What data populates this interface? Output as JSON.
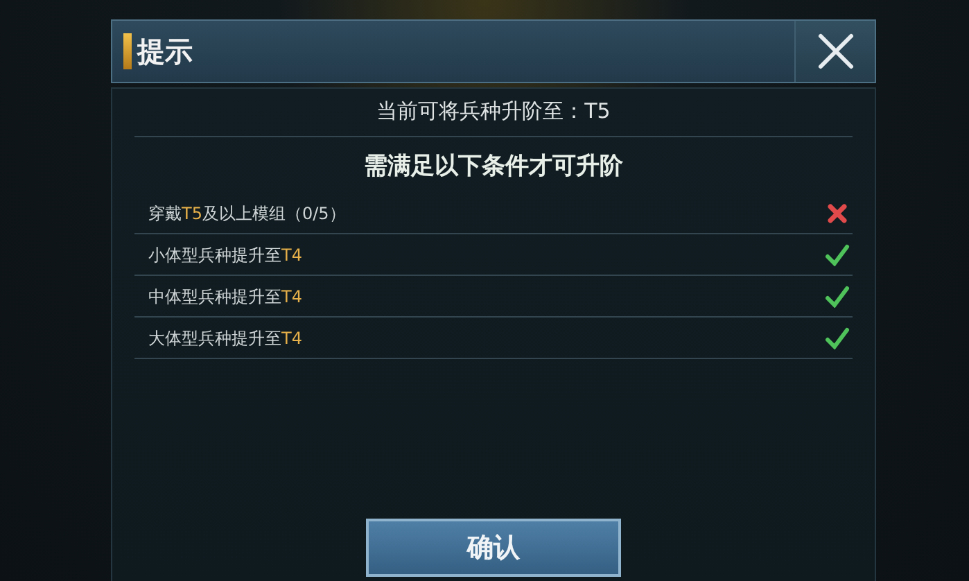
{
  "dialog": {
    "title": "提示",
    "subtitle": "当前可将兵种升阶至：T5",
    "heading": "需满足以下条件才可升阶",
    "conditions": [
      {
        "prefix": "穿戴",
        "tier": "T5",
        "suffix": "及以上模组（0/5）",
        "met": false
      },
      {
        "prefix": "小体型兵种提升至",
        "tier": "T4",
        "met": true
      },
      {
        "prefix": "中体型兵种提升至",
        "tier": "T4",
        "met": true
      },
      {
        "prefix": "大体型兵种提升至",
        "tier": "T4",
        "met": true
      }
    ],
    "confirm": "确认"
  }
}
